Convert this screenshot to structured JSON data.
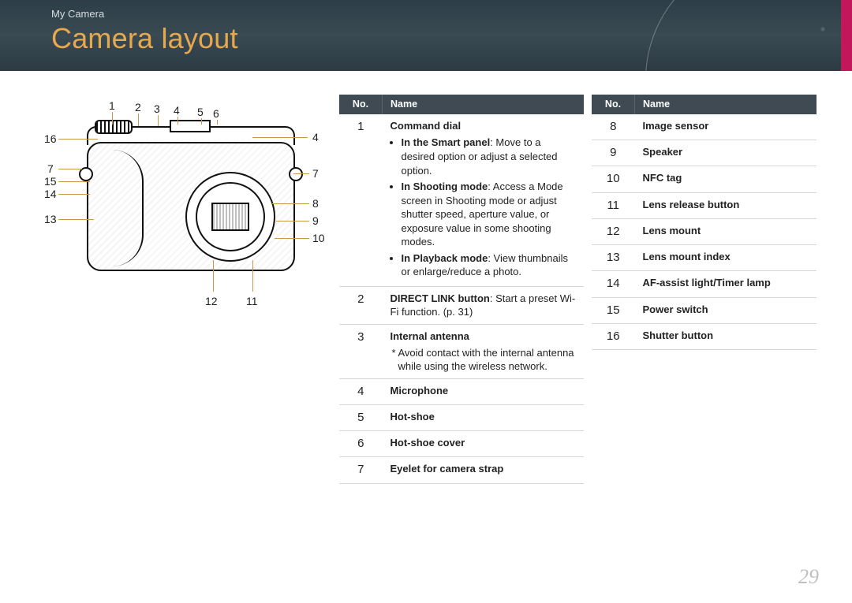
{
  "header": {
    "breadcrumb": "My Camera",
    "title": "Camera layout"
  },
  "page_number": "29",
  "table_headers": {
    "no": "No.",
    "name": "Name"
  },
  "diagram_callouts": {
    "n1": "1",
    "n2": "2",
    "n3": "3",
    "n4": "4",
    "n5": "5",
    "n6": "6",
    "r4": "4",
    "r7": "7",
    "r8": "8",
    "r9": "9",
    "r10": "10",
    "l7": "7",
    "l13": "13",
    "l14": "14",
    "l15": "15",
    "l16": "16",
    "b11": "11",
    "b12": "12"
  },
  "table1": [
    {
      "no": "1",
      "name": "Command dial",
      "bullets": [
        {
          "bold": "In the Smart panel",
          "rest": ": Move to a desired option or adjust a selected option."
        },
        {
          "bold": "In Shooting mode",
          "rest": ": Access a Mode screen in Shooting mode or adjust shutter speed, aperture value, or exposure value in some shooting modes."
        },
        {
          "bold": "In Playback mode",
          "rest": ": View thumbnails or enlarge/reduce a photo."
        }
      ]
    },
    {
      "no": "2",
      "inline_bold": "DIRECT LINK button",
      "inline_rest": ": Start a preset Wi-Fi function. (p. 31)"
    },
    {
      "no": "3",
      "name": "Internal antenna",
      "note": "* Avoid contact with the internal antenna while using the wireless network."
    },
    {
      "no": "4",
      "name": "Microphone"
    },
    {
      "no": "5",
      "name": "Hot-shoe"
    },
    {
      "no": "6",
      "name": "Hot-shoe cover"
    },
    {
      "no": "7",
      "name": "Eyelet for camera strap"
    }
  ],
  "table2": [
    {
      "no": "8",
      "name": "Image sensor"
    },
    {
      "no": "9",
      "name": "Speaker"
    },
    {
      "no": "10",
      "name": "NFC tag"
    },
    {
      "no": "11",
      "name": "Lens release button"
    },
    {
      "no": "12",
      "name": "Lens mount"
    },
    {
      "no": "13",
      "name": "Lens mount index"
    },
    {
      "no": "14",
      "name": "AF-assist light/Timer lamp"
    },
    {
      "no": "15",
      "name": "Power switch"
    },
    {
      "no": "16",
      "name": "Shutter button"
    }
  ]
}
